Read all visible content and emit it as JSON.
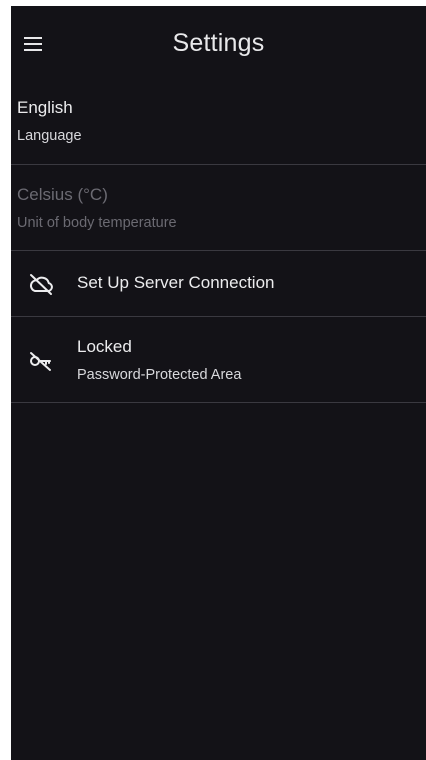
{
  "app_bar": {
    "title": "Settings",
    "menu_icon": "menu-icon"
  },
  "settings": {
    "language": {
      "value": "English",
      "label": "Language"
    },
    "temperature_unit": {
      "value": "Celsius (°C)",
      "label": "Unit of body temperature",
      "enabled": false
    },
    "server_connection": {
      "label": "Set Up Server Connection",
      "icon": "cloud-off-icon"
    },
    "protected_area": {
      "value": "Locked",
      "label": "Password-Protected Area",
      "icon": "key-off-icon"
    }
  },
  "colors": {
    "background": "#131217",
    "divider": "#3a3940",
    "text_primary": "#ececee",
    "text_disabled": "#6b6a72"
  }
}
